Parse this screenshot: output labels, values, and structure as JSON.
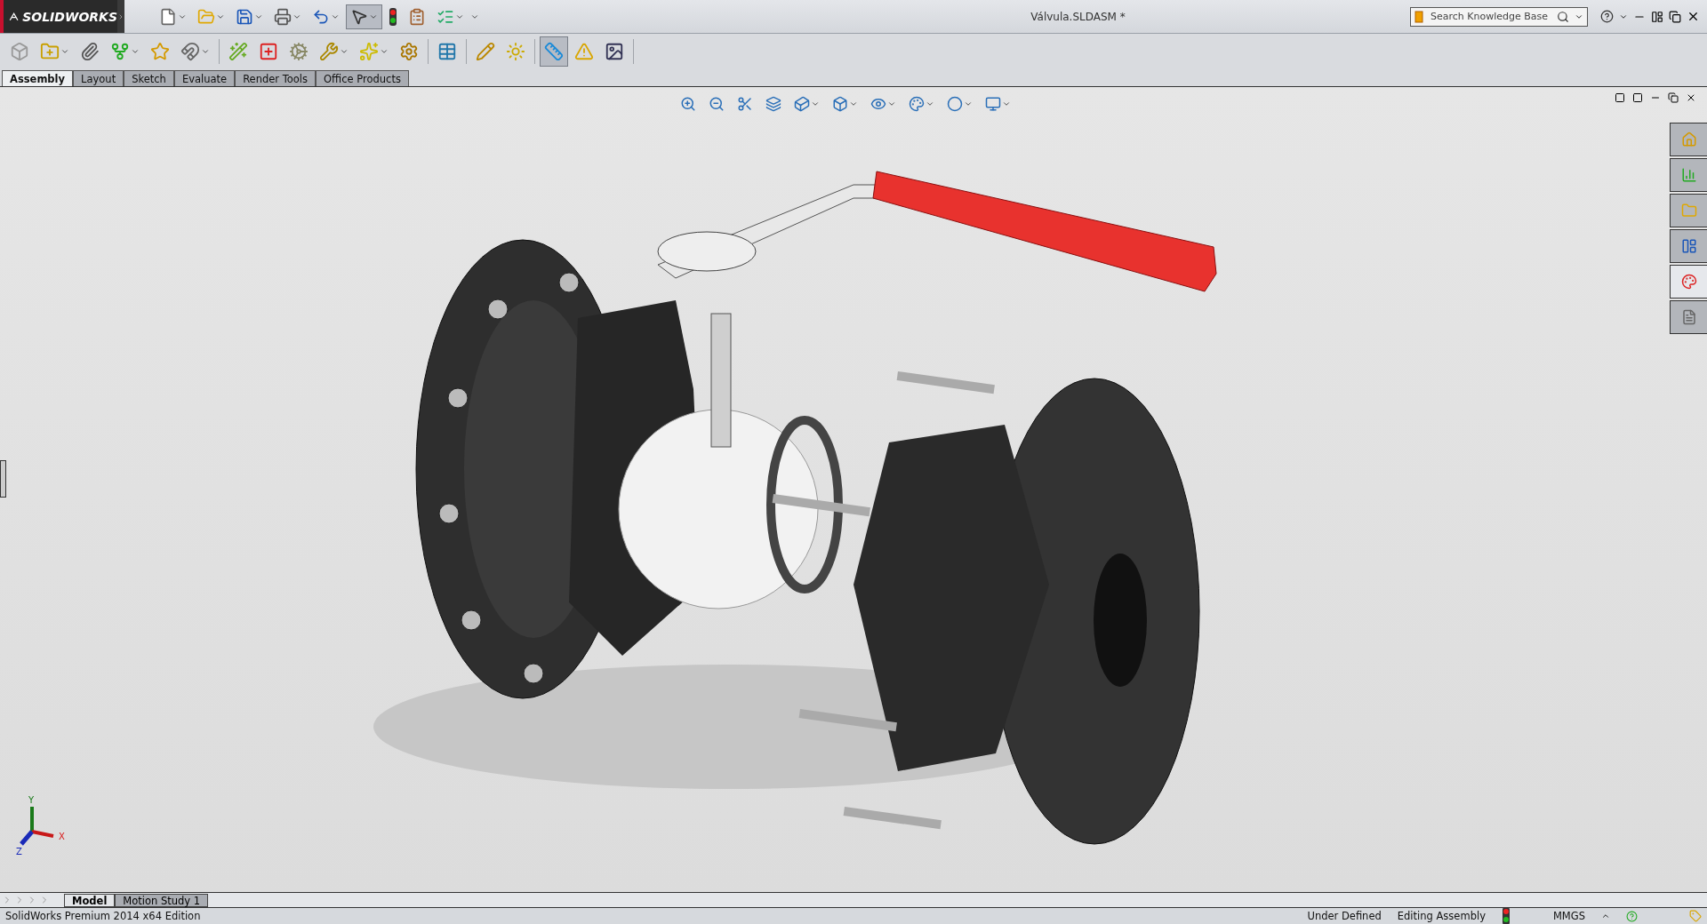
{
  "title_bar": {
    "logo": "SOLIDWORKS",
    "document_title": "Válvula.SLDASM *",
    "search": {
      "placeholder": "Search Knowledge Base"
    }
  },
  "quick_access_buttons": [
    {
      "pressed": false
    },
    {
      "pressed": false
    },
    {
      "pressed": false
    },
    {
      "pressed": false
    },
    {
      "pressed": false
    },
    {
      "pressed": true
    },
    {
      "pressed": false
    },
    {
      "pressed": false
    },
    {
      "pressed": false
    }
  ],
  "command_buttons": [
    {
      "pressed": false
    },
    {
      "pressed": false
    },
    {
      "pressed": false
    },
    {
      "pressed": false
    },
    {
      "pressed": false
    },
    {
      "pressed": false
    },
    {
      "pressed": false
    },
    {
      "pressed": false
    },
    {
      "pressed": false
    },
    {
      "pressed": false
    },
    {
      "pressed": false
    },
    {
      "pressed": false
    },
    {
      "pressed": false
    },
    {
      "pressed": false
    },
    {
      "pressed": false
    },
    {
      "pressed": true
    },
    {
      "pressed": false
    },
    {
      "pressed": false
    }
  ],
  "tabs": [
    {
      "label": "Assembly",
      "selected": true
    },
    {
      "label": "Layout",
      "selected": false
    },
    {
      "label": "Sketch",
      "selected": false
    },
    {
      "label": "Evaluate",
      "selected": false
    },
    {
      "label": "Render Tools",
      "selected": false
    },
    {
      "label": "Office Products",
      "selected": false
    }
  ],
  "task_pane": [
    {
      "selected": false
    },
    {
      "selected": false
    },
    {
      "selected": false
    },
    {
      "selected": false
    },
    {
      "selected": true
    },
    {
      "selected": false
    }
  ],
  "triad": {
    "x": "X",
    "y": "Y",
    "z": "Z"
  },
  "view_tabs": [
    {
      "label": "Model",
      "selected": true
    },
    {
      "label": "Motion Study 1",
      "selected": false
    }
  ],
  "status_bar": {
    "edition": "SolidWorks Premium 2014 x64 Edition",
    "definition": "Under Defined",
    "mode": "Editing Assembly",
    "units": "MMGS"
  }
}
